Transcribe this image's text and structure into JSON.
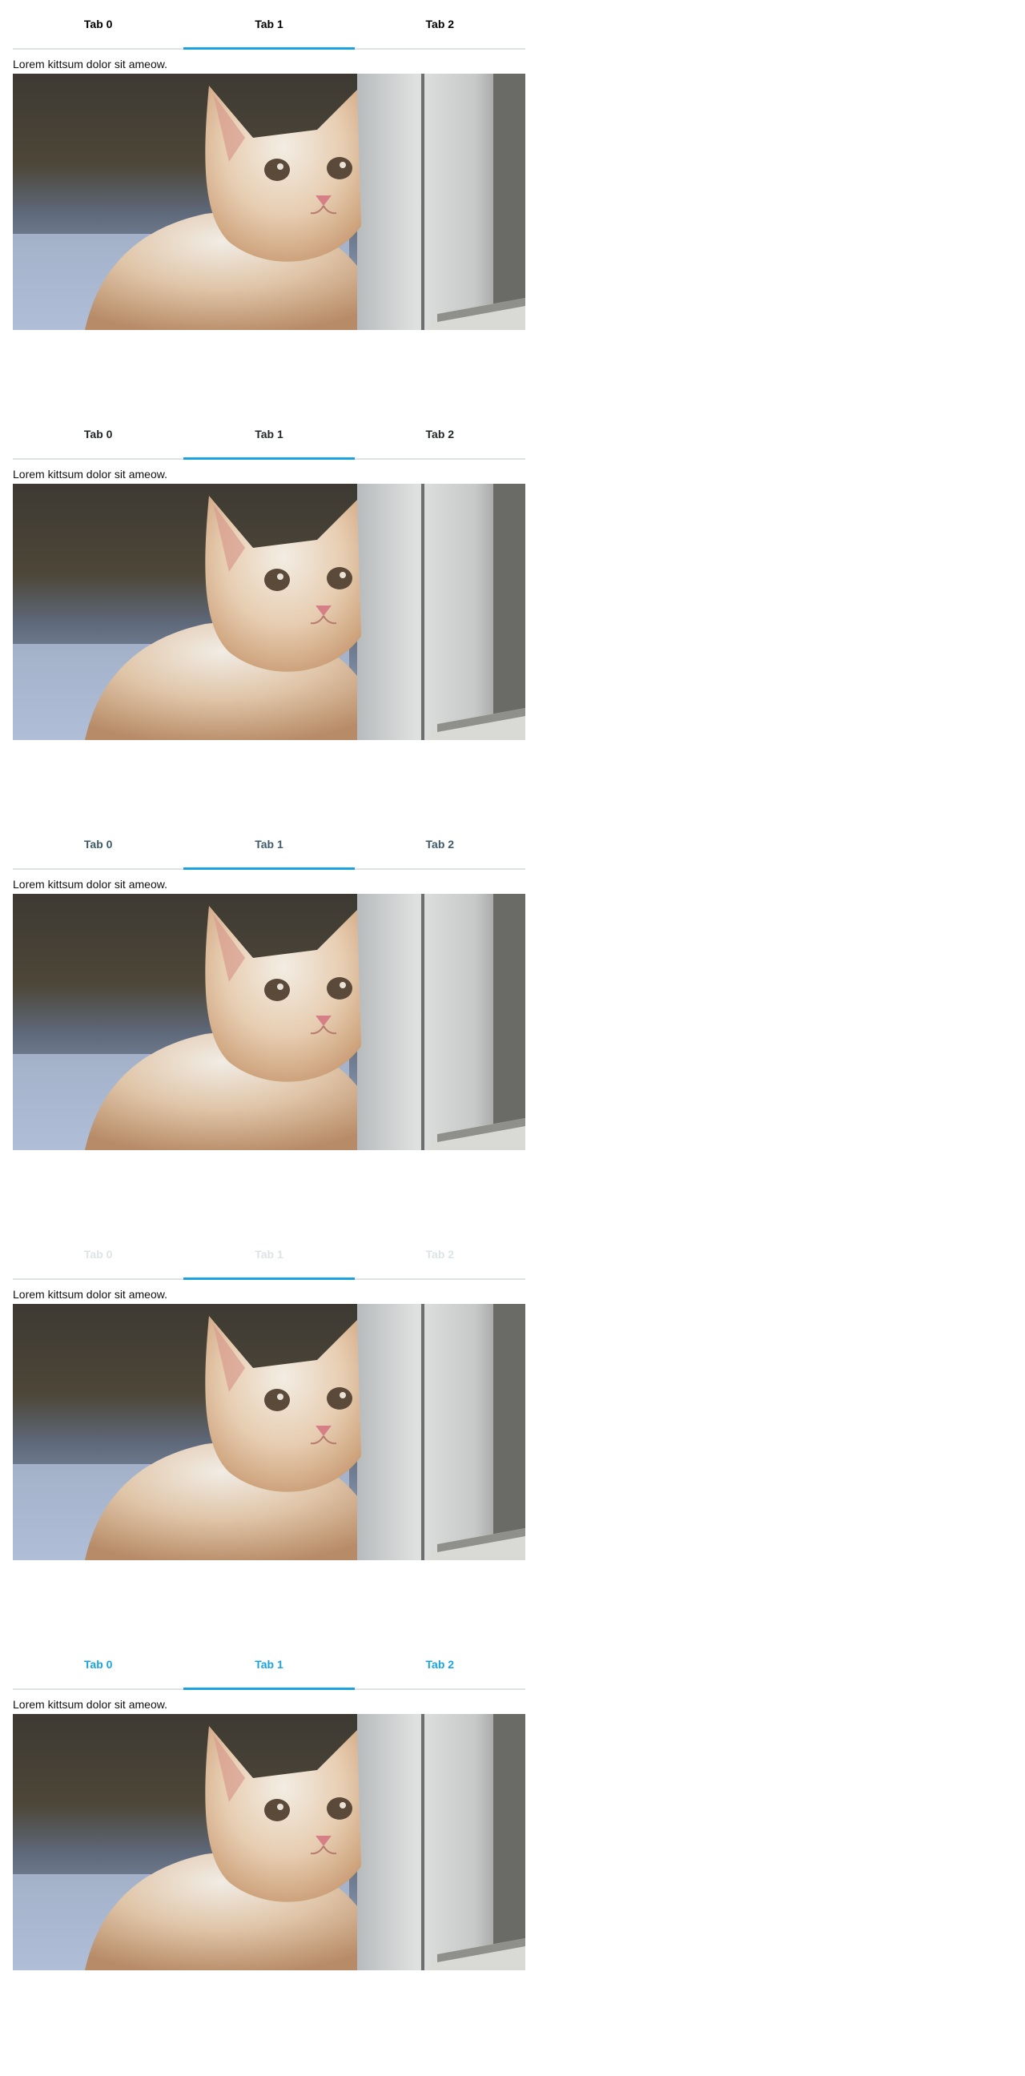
{
  "demos": [
    {
      "tabs": [
        {
          "label": "Tab 0"
        },
        {
          "label": "Tab 1"
        },
        {
          "label": "Tab 2"
        }
      ],
      "caption": "Lorem kittsum dolor sit ameow."
    },
    {
      "tabs": [
        {
          "label": "Tab 0"
        },
        {
          "label": "Tab 1"
        },
        {
          "label": "Tab 2"
        }
      ],
      "caption": "Lorem kittsum dolor sit ameow."
    },
    {
      "tabs": [
        {
          "label": "Tab 0"
        },
        {
          "label": "Tab 1"
        },
        {
          "label": "Tab 2"
        }
      ],
      "caption": "Lorem kittsum dolor sit ameow."
    },
    {
      "tabs": [
        {
          "label": "Tab 0"
        },
        {
          "label": "Tab 1"
        },
        {
          "label": "Tab 2"
        }
      ],
      "caption": "Lorem kittsum dolor sit ameow."
    },
    {
      "tabs": [
        {
          "label": "Tab 0"
        },
        {
          "label": "Tab 1"
        },
        {
          "label": "Tab 2"
        }
      ],
      "caption": "Lorem kittsum dolor sit ameow."
    }
  ],
  "colors": {
    "active_indicator": "#1aa3e0",
    "tab_border": "#dfe2e4",
    "variant_text": [
      "#000000",
      "#23272b",
      "#3e5a6a",
      "#dde3e6",
      "#1aa3e0"
    ]
  },
  "active_tab_index": 1,
  "image_alt": "cat-photo"
}
